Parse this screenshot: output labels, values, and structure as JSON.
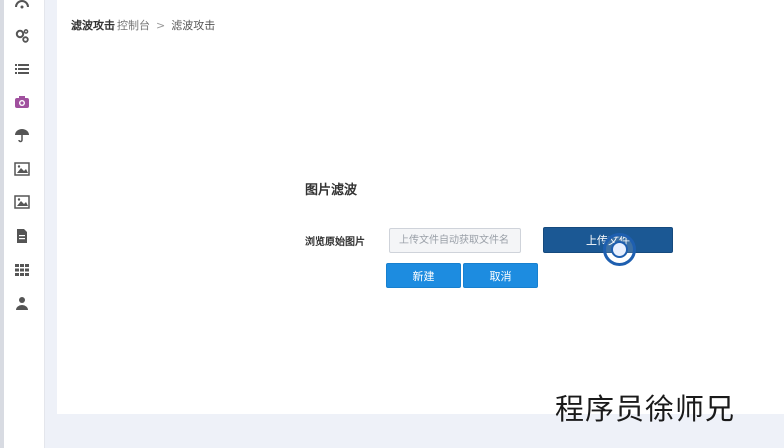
{
  "breadcrumb": {
    "home": "滤波攻击",
    "home_sub": "控制台",
    "separator": ">",
    "current": "滤波攻击"
  },
  "sidebar": {
    "items": [
      {
        "icon": "dashboard-icon"
      },
      {
        "icon": "gears-icon"
      },
      {
        "icon": "list-icon"
      },
      {
        "icon": "camera-icon",
        "color": "#a0509e"
      },
      {
        "icon": "umbrella-icon"
      },
      {
        "icon": "image-icon"
      },
      {
        "icon": "image-icon"
      },
      {
        "icon": "document-icon"
      },
      {
        "icon": "grid-icon"
      },
      {
        "icon": "user-icon"
      }
    ]
  },
  "form": {
    "title": "图片滤波",
    "field_label": "浏览原始图片",
    "file_placeholder": "上传文件自动获取文件名",
    "upload_label": "上传文件",
    "new_label": "新建",
    "cancel_label": "取消"
  },
  "watermark": "程序员徐师兄",
  "colors": {
    "upload_button": "#1b5894",
    "primary_button": "#1d8ce0",
    "active_sidebar_icon": "#a0509e"
  }
}
